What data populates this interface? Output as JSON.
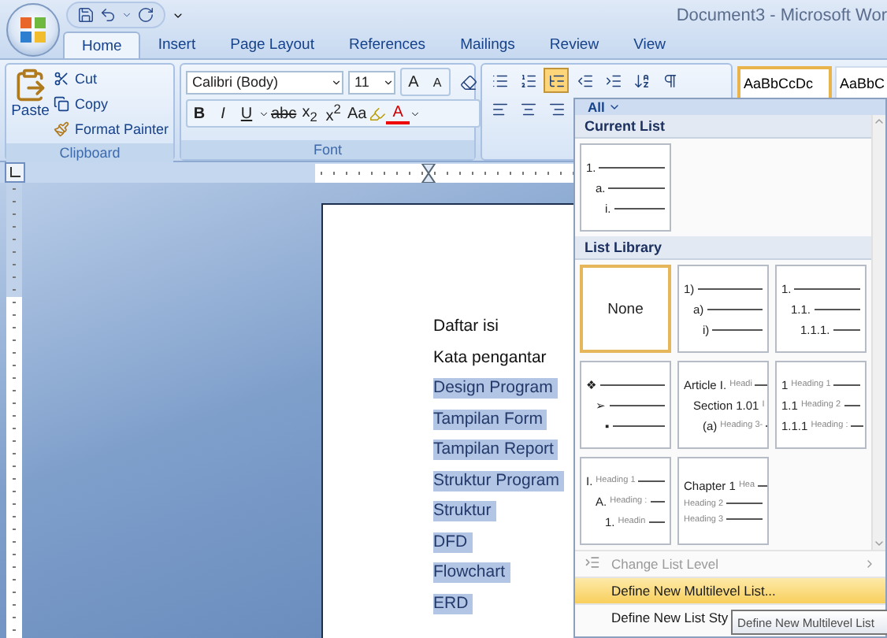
{
  "window": {
    "title": "Document3 - Microsoft Wor"
  },
  "tabs": [
    {
      "label": "Home",
      "selected": true
    },
    {
      "label": "Insert",
      "selected": false
    },
    {
      "label": "Page Layout",
      "selected": false
    },
    {
      "label": "References",
      "selected": false
    },
    {
      "label": "Mailings",
      "selected": false
    },
    {
      "label": "Review",
      "selected": false
    },
    {
      "label": "View",
      "selected": false
    }
  ],
  "clipboard": {
    "paste": "Paste",
    "cut": "Cut",
    "copy": "Copy",
    "format_painter": "Format Painter",
    "label": "Clipboard"
  },
  "font": {
    "name": "Calibri (Body)",
    "size": "11",
    "grow": "A",
    "shrink": "A",
    "bold": "B",
    "italic": "I",
    "underline": "U",
    "strike": "abc",
    "subscript": "x$_{2}$",
    "superscript": "x$^{2}$",
    "change_case": "Aa",
    "font_color": "A",
    "label": "Font"
  },
  "paragraph": {
    "multilevel_active": true
  },
  "styles": [
    {
      "label": "AaBbCcDc",
      "selected": true
    },
    {
      "label": "AaBbC",
      "selected": false
    }
  ],
  "document": {
    "lines": [
      {
        "text": "Daftar isi",
        "selected": false
      },
      {
        "text": "Kata pengantar",
        "selected": false
      },
      {
        "text": "Design Program",
        "selected": true
      },
      {
        "text": "Tampilan Form",
        "selected": true
      },
      {
        "text": "Tampilan Report",
        "selected": true
      },
      {
        "text": "Struktur Program",
        "selected": true
      },
      {
        "text": "Struktur",
        "selected": true
      },
      {
        "text": "DFD",
        "selected": true
      },
      {
        "text": "Flowchart",
        "selected": true
      },
      {
        "text": "ERD",
        "selected": true
      }
    ]
  },
  "list_menu": {
    "filter": "All",
    "current_heading": "Current List",
    "current": [
      {
        "kind": "stepped",
        "selected": false,
        "rows": [
          {
            "marker": "1."
          },
          {
            "marker": "a."
          },
          {
            "marker": "i."
          }
        ]
      }
    ],
    "library_heading": "List Library",
    "library": [
      {
        "kind": "none",
        "label": "None",
        "selected": true
      },
      {
        "kind": "stepped",
        "selected": false,
        "rows": [
          {
            "marker": "1)"
          },
          {
            "marker": "a)"
          },
          {
            "marker": "i)"
          }
        ]
      },
      {
        "kind": "stepped",
        "selected": false,
        "rows": [
          {
            "marker": "1."
          },
          {
            "marker": "1.1."
          },
          {
            "marker": "1.1.1."
          }
        ]
      },
      {
        "kind": "stepped",
        "selected": false,
        "rows": [
          {
            "marker": "❖"
          },
          {
            "marker": "➢"
          },
          {
            "marker": "▪"
          }
        ]
      },
      {
        "kind": "stepped",
        "selected": false,
        "rows": [
          {
            "marker": "Article I.",
            "heading": "Headi"
          },
          {
            "marker": "Section 1.01",
            "heading": "I"
          },
          {
            "marker": "(a)",
            "heading": "Heading 3-"
          }
        ]
      },
      {
        "kind": "flat",
        "selected": false,
        "rows": [
          {
            "marker": "1",
            "heading": "Heading 1"
          },
          {
            "marker": "1.1",
            "heading": "Heading 2"
          },
          {
            "marker": "1.1.1",
            "heading": "Heading :"
          }
        ]
      },
      {
        "kind": "stepped",
        "selected": false,
        "rows": [
          {
            "marker": "I.",
            "heading": "Heading 1"
          },
          {
            "marker": "A.",
            "heading": "Heading :"
          },
          {
            "marker": "1.",
            "heading": "Headin"
          }
        ]
      },
      {
        "kind": "flat",
        "selected": false,
        "rows": [
          {
            "marker": "Chapter 1",
            "heading": "Hea"
          },
          {
            "heading": "Heading 2"
          },
          {
            "heading": "Heading 3"
          }
        ]
      }
    ],
    "items": [
      {
        "label": "Change List Level",
        "disabled": true,
        "selected": false,
        "kind": "submenu"
      },
      {
        "label": "Define New Multilevel List...",
        "disabled": false,
        "selected": true,
        "kind": "plain"
      },
      {
        "label": "Define New List Sty",
        "disabled": false,
        "selected": false,
        "kind": "plain"
      }
    ]
  },
  "tooltip": "Define New Multilevel List"
}
